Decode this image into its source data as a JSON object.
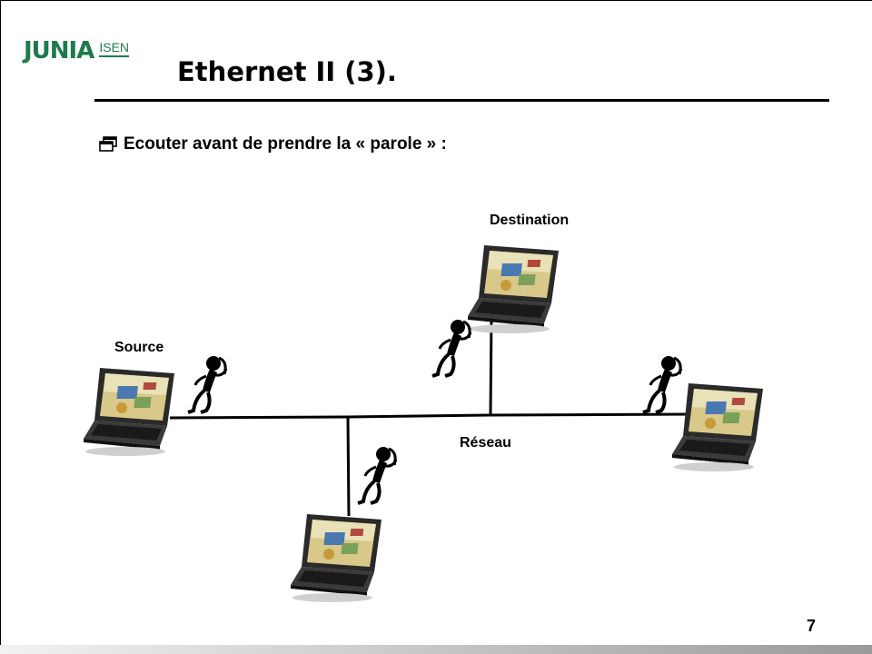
{
  "slide": {
    "logo": {
      "brand": "JUNIA",
      "school": "ISEN",
      "color": "#1e7a4b"
    },
    "title": "Ethernet II (3).",
    "bullet": {
      "icon": "window-bullet-icon",
      "text": "Ecouter avant de prendre la « parole » :"
    },
    "page_number": "7"
  },
  "diagram": {
    "labels": {
      "destination": "Destination",
      "source": "Source",
      "reseau": "Réseau"
    },
    "nodes": [
      {
        "id": "source",
        "icon": "laptop-icon"
      },
      {
        "id": "destination",
        "icon": "laptop-icon"
      },
      {
        "id": "right",
        "icon": "laptop-icon"
      },
      {
        "id": "bottom",
        "icon": "laptop-icon"
      }
    ],
    "listeners": [
      {
        "id": "source",
        "icon": "listening-person-icon"
      },
      {
        "id": "destination",
        "icon": "listening-person-icon"
      },
      {
        "id": "right",
        "icon": "listening-person-icon"
      },
      {
        "id": "bottom",
        "icon": "listening-person-icon"
      }
    ]
  }
}
